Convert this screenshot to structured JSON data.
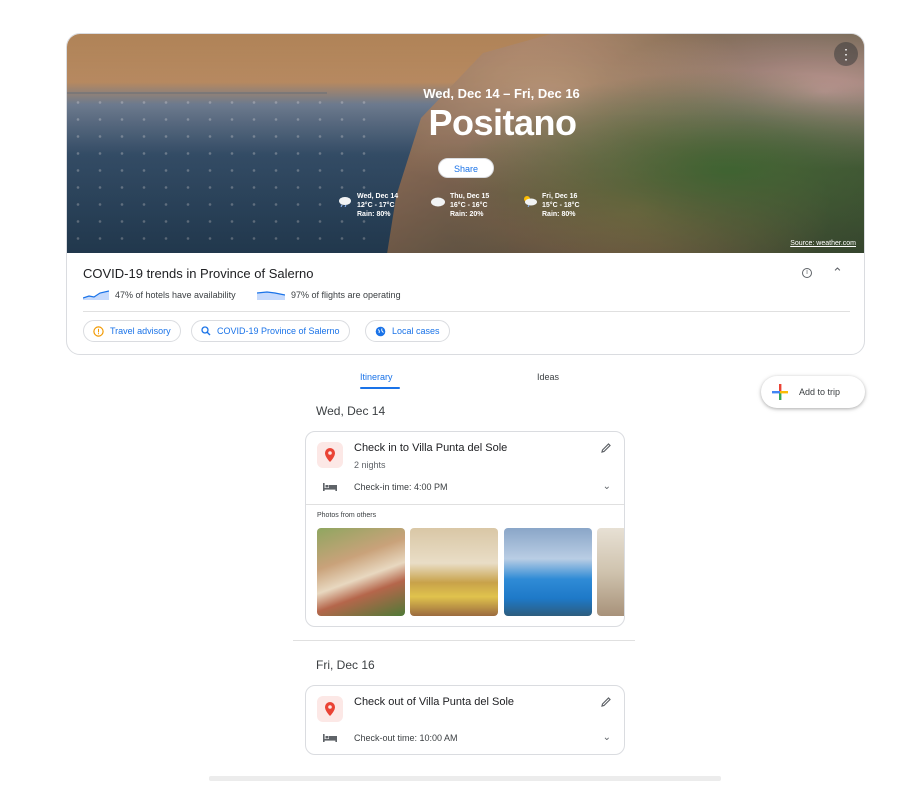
{
  "hero": {
    "dates": "Wed, Dec 14 – Fri, Dec 16",
    "city": "Positano",
    "share_label": "Share",
    "more_icon": "more-vert-icon",
    "source_label": "Source: weather.com",
    "weather": [
      {
        "day": "Wed, Dec 14",
        "temp": "12°C - 17°C",
        "rain": "Rain: 80%",
        "icon": "rain-cloud-icon"
      },
      {
        "day": "Thu, Dec 15",
        "temp": "16°C - 16°C",
        "rain": "Rain: 20%",
        "icon": "cloud-icon"
      },
      {
        "day": "Fri, Dec 16",
        "temp": "15°C - 18°C",
        "rain": "Rain: 80%",
        "icon": "sun-cloud-rain-icon"
      }
    ]
  },
  "covid": {
    "title": "COVID-19 trends in Province of Salerno",
    "hotels": "47% of hotels have availability",
    "flights": "97% of flights are operating",
    "chips": [
      {
        "label": "Travel advisory",
        "icon": "warning-circle-icon"
      },
      {
        "label": "COVID-19 Province of Salerno",
        "icon": "search-icon"
      },
      {
        "label": "Local cases",
        "icon": "globe-icon"
      }
    ]
  },
  "tabs": {
    "itinerary": "Itinerary",
    "ideas": "Ideas"
  },
  "add_to_trip": "Add to trip",
  "days": [
    {
      "heading": "Wed, Dec 14",
      "title": "Check in to Villa Punta del Sole",
      "subtitle": "2 nights",
      "time": "Check-in time: 4:00 PM",
      "photos_label": "Photos from others"
    },
    {
      "heading": "Fri, Dec 16",
      "title": "Check out of Villa Punta del Sole",
      "time": "Check-out time: 10:00 AM"
    }
  ],
  "colors": {
    "accent": "#1a73e8",
    "pin": "#ea4335",
    "advisory": "#f29900"
  }
}
